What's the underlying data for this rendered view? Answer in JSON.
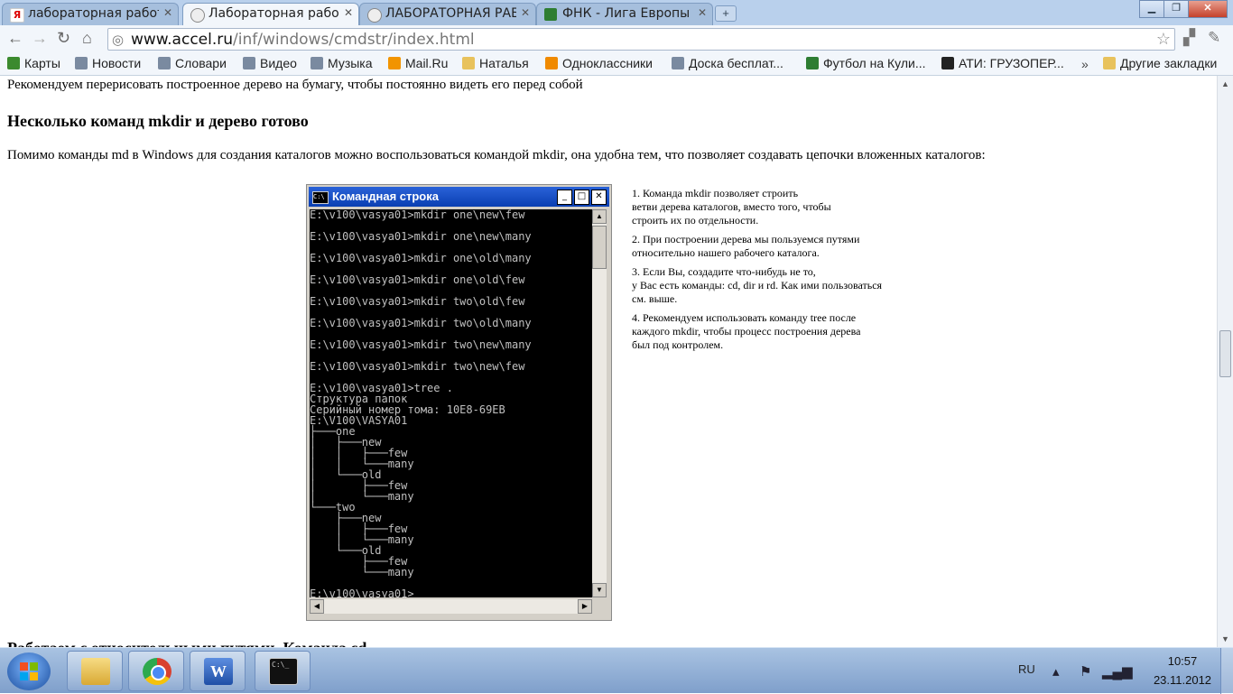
{
  "tabs": [
    {
      "label": "лабораторная работ",
      "active": false,
      "icon": "yandex-icon",
      "color": "#e8e8e8"
    },
    {
      "label": "Лабораторная работ",
      "active": true,
      "icon": "page-icon",
      "color": "#8a8a8a"
    },
    {
      "label": "ЛАБОРАТОРНАЯ РАБ",
      "active": false,
      "icon": "page-icon",
      "color": "#8a8a8a"
    },
    {
      "label": "ФНК - Лига Европы :",
      "active": false,
      "icon": "fnk-icon",
      "color": "#2e7d32"
    }
  ],
  "toolbar": {
    "url_host": "www.accel.ru",
    "url_path": "/inf/windows/cmdstr/index.html"
  },
  "bookmarks": [
    {
      "label": "Карты",
      "icon": "maps-icon",
      "color": "#3b8a2e"
    },
    {
      "label": "Новости",
      "icon": "page-icon",
      "color": "#7a8aa0"
    },
    {
      "label": "Словари",
      "icon": "page-icon",
      "color": "#7a8aa0"
    },
    {
      "label": "Видео",
      "icon": "page-icon",
      "color": "#7a8aa0"
    },
    {
      "label": "Музыка",
      "icon": "page-icon",
      "color": "#7a8aa0"
    },
    {
      "label": "Mail.Ru",
      "icon": "mailru-icon",
      "color": "#f29400"
    },
    {
      "label": "Наталья",
      "icon": "folder-icon",
      "color": "#e8c25c"
    },
    {
      "label": "Одноклассники",
      "icon": "odnoklassniki-icon",
      "color": "#f08a00"
    },
    {
      "label": "Доска бесплат...",
      "icon": "page-icon",
      "color": "#7a8aa0"
    },
    {
      "label": "Футбол на Кули...",
      "icon": "fnk-icon",
      "color": "#2e7d32"
    },
    {
      "label": "АТИ: ГРУЗОПЕР...",
      "icon": "ati-icon",
      "color": "#222222"
    }
  ],
  "bookmarks_other": "Другие закладки",
  "content": {
    "p1": "Рекомендуем перерисовать построенное дерево на бумагу, чтобы постоянно видеть его перед собой",
    "h2": "Несколько команд mkdir и дерево готово",
    "p2": "Помимо команды md в Windows для создания каталогов можно воспользоваться командой mkdir, она удобна тем, что позволяет создавать цепочки вложенных каталогов:",
    "h3": "Работаем с относительными путями. Команда cd",
    "cmd_title": "Командная строка",
    "console_lines": [
      "E:\\v100\\vasya01>mkdir one\\new\\few",
      "",
      "E:\\v100\\vasya01>mkdir one\\new\\many",
      "",
      "E:\\v100\\vasya01>mkdir one\\old\\many",
      "",
      "E:\\v100\\vasya01>mkdir one\\old\\few",
      "",
      "E:\\v100\\vasya01>mkdir two\\old\\few",
      "",
      "E:\\v100\\vasya01>mkdir two\\old\\many",
      "",
      "E:\\v100\\vasya01>mkdir two\\new\\many",
      "",
      "E:\\v100\\vasya01>mkdir two\\new\\few",
      "",
      "E:\\v100\\vasya01>tree .",
      "Структура папок",
      "Серийный номер тома: 10E8-69EB",
      "E:\\V100\\VASYA01",
      "├───one",
      "│   ├───new",
      "│   │   ├───few",
      "│   │   └───many",
      "│   └───old",
      "│       ├───few",
      "│       └───many",
      "└───two",
      "    ├───new",
      "    │   ├───few",
      "    │   └───many",
      "    └───old",
      "        ├───few",
      "        └───many",
      "",
      "E:\\v100\\vasya01>"
    ],
    "notes": [
      [
        "1. Команда mkdir позволяет строить",
        "ветви дерева каталогов, вместо того, чтобы",
        "строить их по отдельности."
      ],
      [
        "2. При построении дерева мы пользуемся путями",
        "относительно нашего рабочего каталога."
      ],
      [
        "3. Если Вы, создадите что-нибудь не то,",
        "у Вас есть команды: cd, dir и rd. Как ими пользоваться",
        " см. выше."
      ],
      [
        "4. Рекомендуем использовать команду tree после",
        "каждого mkdir, чтобы процесс построения дерева",
        "был под контролем."
      ]
    ]
  },
  "taskbar": {
    "items": [
      {
        "icon": "explorer-icon",
        "color": "#e9c35a"
      },
      {
        "icon": "chrome-icon",
        "color": "#d9412f"
      },
      {
        "icon": "word-icon",
        "color": "#2a5bb8"
      },
      {
        "icon": "cmd-icon",
        "color": "#111111"
      }
    ],
    "lang": "RU",
    "time": "10:57",
    "date": "23.11.2012"
  }
}
